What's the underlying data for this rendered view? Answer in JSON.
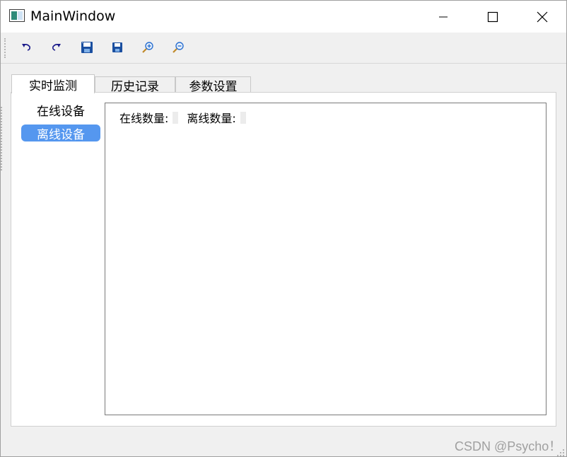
{
  "window": {
    "title": "MainWindow"
  },
  "toolbar": {
    "items": [
      {
        "name": "undo",
        "icon": "undo-icon"
      },
      {
        "name": "redo",
        "icon": "redo-icon"
      },
      {
        "name": "save",
        "icon": "save-icon"
      },
      {
        "name": "save-as",
        "icon": "save-icon"
      },
      {
        "name": "zoom-in",
        "icon": "zoom-in-icon"
      },
      {
        "name": "zoom-out",
        "icon": "zoom-out-icon"
      }
    ]
  },
  "tabs": [
    {
      "label": "实时监测",
      "active": true
    },
    {
      "label": "历史记录",
      "active": false
    },
    {
      "label": "参数设置",
      "active": false
    }
  ],
  "sidebar": {
    "items": [
      {
        "label": "在线设备",
        "selected": false
      },
      {
        "label": "离线设备",
        "selected": true
      }
    ]
  },
  "main": {
    "online_count_label": "在线数量:",
    "offline_count_label": "离线数量:",
    "online_count": "",
    "offline_count": ""
  },
  "watermark": "CSDN @Psycho！",
  "colors": {
    "selection": "#5597ef",
    "save_icon": "#1a4fa0",
    "zoom_icon": "#2a6fd0"
  }
}
